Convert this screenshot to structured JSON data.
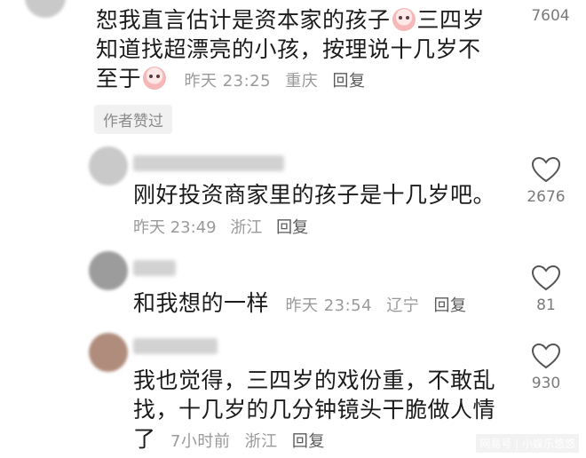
{
  "top_comment": {
    "content_lines": [
      "恕我直言估计是资本家的孩子",
      "三四岁",
      "知道找超漂亮的小孩，按理说十几岁不",
      "至于"
    ],
    "time": "昨天 23:25",
    "location": "重庆",
    "reply": "回复",
    "author_liked": "作者赞过",
    "likes": "7604"
  },
  "replies": [
    {
      "content_lines": [
        "刚好投资商家里的孩子是十几岁吧。"
      ],
      "time": "昨天 23:49",
      "location": "浙江",
      "reply": "回复",
      "likes": "2676"
    },
    {
      "content_lines": [
        "和我想的一样"
      ],
      "time": "昨天 23:54",
      "location": "辽宁",
      "reply": "回复",
      "likes": "81"
    },
    {
      "content_lines": [
        "我也觉得，三四岁的戏份重，不敢乱",
        "找，十几岁的几分钟镜头干脆做人情",
        "了"
      ],
      "time": "7小时前",
      "location": "浙江",
      "reply": "回复",
      "likes": "930"
    }
  ],
  "watermark": "网易号 | 小娱乐悠悠"
}
